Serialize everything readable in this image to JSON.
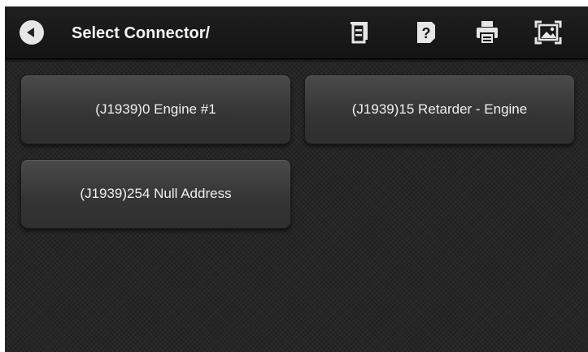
{
  "header": {
    "title": "Select Connector/",
    "icons": [
      "back-icon",
      "document-icon",
      "help-icon",
      "print-icon",
      "screenshot-icon"
    ]
  },
  "connectors": [
    {
      "label": "(J1939)0 Engine #1"
    },
    {
      "label": "(J1939)15 Retarder - Engine"
    },
    {
      "label": "(J1939)254 Null Address"
    }
  ],
  "colors": {
    "background": "#2a2a2a",
    "header": "#1a1a1a",
    "button": "#3e3e3e",
    "text": "#f0f0f0",
    "icon": "#e6e6e6"
  }
}
